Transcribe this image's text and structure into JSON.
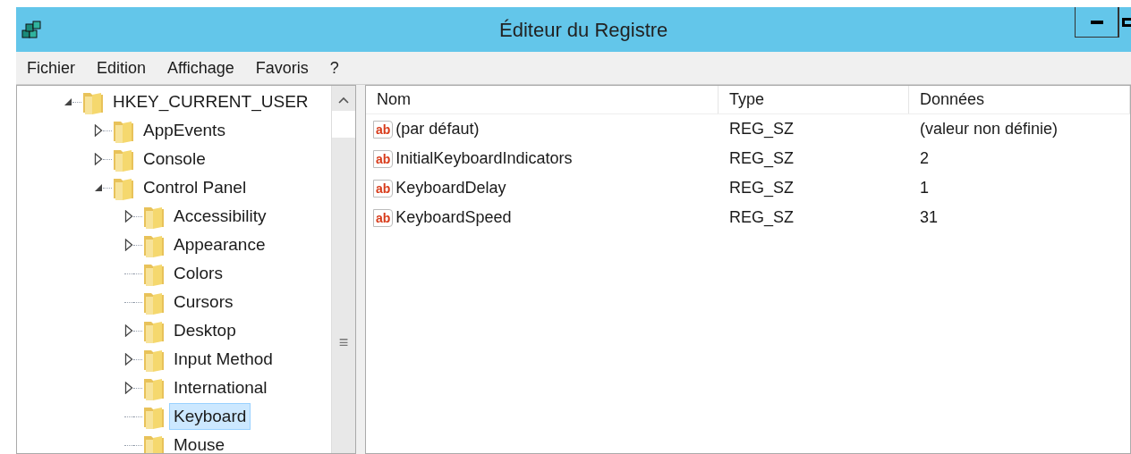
{
  "window": {
    "title": "Éditeur du Registre"
  },
  "menu": [
    "Fichier",
    "Edition",
    "Affichage",
    "Favoris",
    "?"
  ],
  "tree": [
    {
      "label": "HKEY_CURRENT_USER",
      "kind": "branch",
      "expanded": true,
      "selected": false,
      "children": [
        {
          "label": "AppEvents",
          "kind": "branch",
          "expanded": false,
          "selected": false
        },
        {
          "label": "Console",
          "kind": "branch",
          "expanded": false,
          "selected": false
        },
        {
          "label": "Control Panel",
          "kind": "branch",
          "expanded": true,
          "selected": false,
          "children": [
            {
              "label": "Accessibility",
              "kind": "branch",
              "expanded": false,
              "selected": false
            },
            {
              "label": "Appearance",
              "kind": "branch",
              "expanded": false,
              "selected": false
            },
            {
              "label": "Colors",
              "kind": "leaf",
              "selected": false
            },
            {
              "label": "Cursors",
              "kind": "leaf",
              "selected": false
            },
            {
              "label": "Desktop",
              "kind": "branch",
              "expanded": false,
              "selected": false
            },
            {
              "label": "Input Method",
              "kind": "branch",
              "expanded": false,
              "selected": false
            },
            {
              "label": "International",
              "kind": "branch",
              "expanded": false,
              "selected": false
            },
            {
              "label": "Keyboard",
              "kind": "leaf",
              "selected": true
            },
            {
              "label": "Mouse",
              "kind": "leaf",
              "selected": false
            }
          ]
        }
      ]
    }
  ],
  "scrollbar": {
    "grip": "≡"
  },
  "table": {
    "columns": [
      "Nom",
      "Type",
      "Données"
    ],
    "rows": [
      {
        "icon_text": "ab",
        "name": "(par défaut)",
        "type": "REG_SZ",
        "data": "(valeur non définie)"
      },
      {
        "icon_text": "ab",
        "name": "InitialKeyboardIndicators",
        "type": "REG_SZ",
        "data": "2"
      },
      {
        "icon_text": "ab",
        "name": "KeyboardDelay",
        "type": "REG_SZ",
        "data": "1"
      },
      {
        "icon_text": "ab",
        "name": "KeyboardSpeed",
        "type": "REG_SZ",
        "data": "31"
      }
    ]
  }
}
